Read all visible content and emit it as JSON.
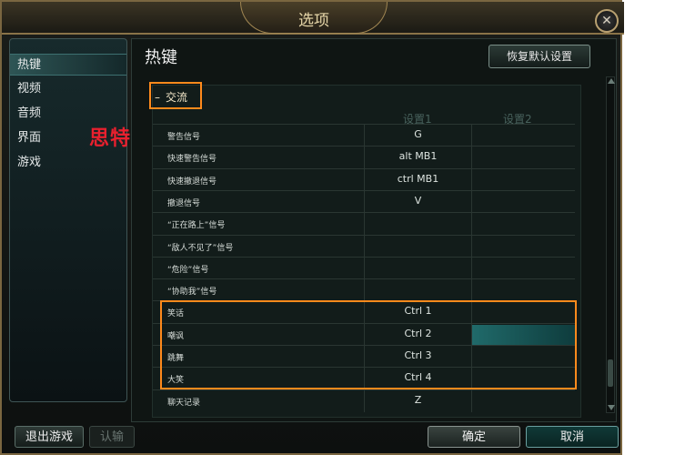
{
  "window": {
    "title": "选项",
    "close_glyph": "✕"
  },
  "sidebar": {
    "items": [
      "热键",
      "视频",
      "音频",
      "界面",
      "游戏"
    ]
  },
  "watermark": "思特网",
  "header": {
    "title": "热键",
    "restore_button": "恢复默认设置"
  },
  "category": {
    "toggle": "–",
    "label": "交流"
  },
  "columns": [
    "设置1",
    "设置2"
  ],
  "rows": [
    {
      "name": "警告信号",
      "setting1": "G",
      "setting2": ""
    },
    {
      "name": "快速警告信号",
      "setting1": "alt  MB1",
      "setting2": ""
    },
    {
      "name": "快速撤退信号",
      "setting1": "ctrl  MB1",
      "setting2": ""
    },
    {
      "name": "撤退信号",
      "setting1": "V",
      "setting2": ""
    },
    {
      "name": "“正在路上”信号",
      "setting1": "",
      "setting2": ""
    },
    {
      "name": "“敌人不见了”信号",
      "setting1": "",
      "setting2": ""
    },
    {
      "name": "“危险”信号",
      "setting1": "",
      "setting2": ""
    },
    {
      "name": "“协助我”信号",
      "setting1": "",
      "setting2": ""
    },
    {
      "name": "笑话",
      "setting1": "Ctrl  1",
      "setting2": ""
    },
    {
      "name": "嘲讽",
      "setting1": "Ctrl  2",
      "setting2": "",
      "selected": true
    },
    {
      "name": "跳舞",
      "setting1": "Ctrl  3",
      "setting2": ""
    },
    {
      "name": "大笑",
      "setting1": "Ctrl  4",
      "setting2": ""
    },
    {
      "name": "聊天记录",
      "setting1": "Z",
      "setting2": ""
    }
  ],
  "footer": {
    "exit": "退出游戏",
    "vote": "认输",
    "ok": "确定",
    "cancel": "取消"
  },
  "colors": {
    "accent": "#ff8a1c",
    "selected_cell": "#206a6a"
  }
}
